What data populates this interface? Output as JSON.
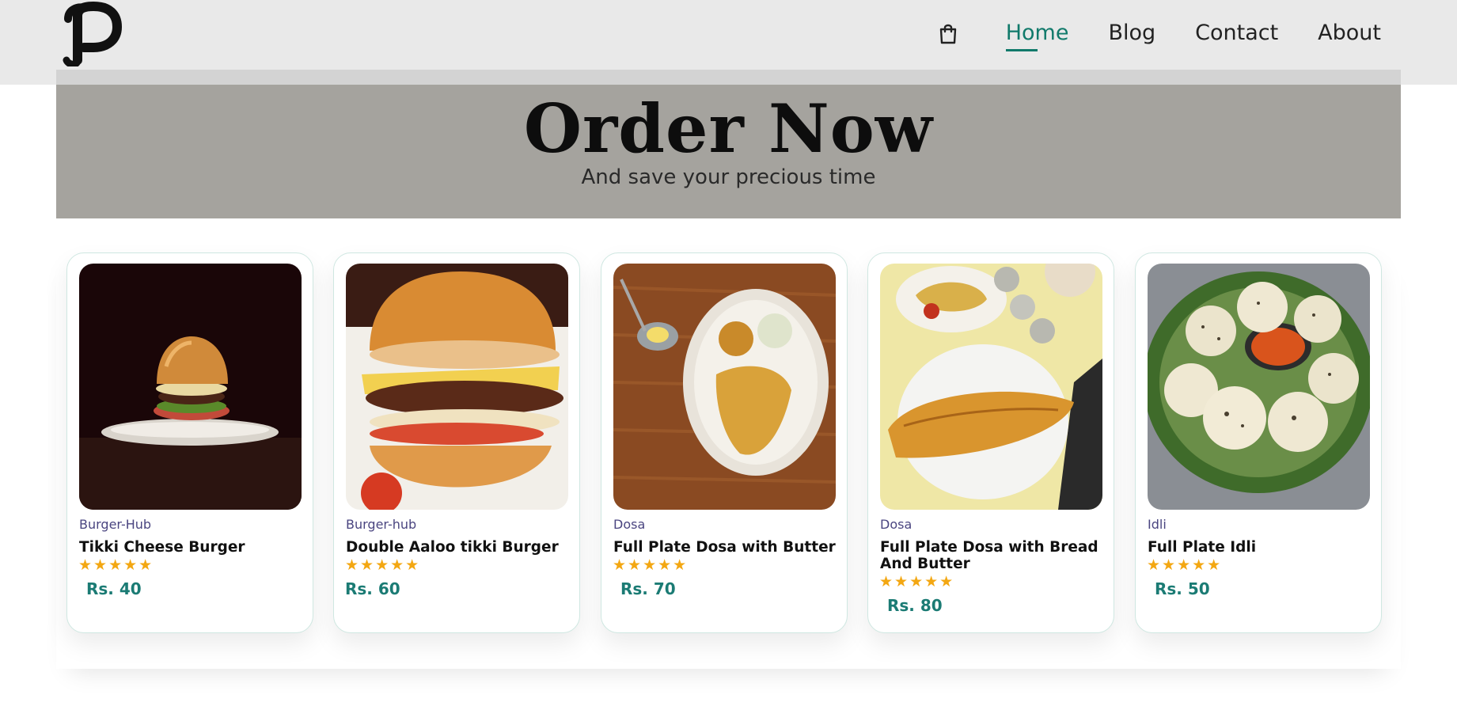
{
  "header": {
    "logo_icon": "p-logo-icon",
    "cart_icon": "shopping-bag-icon",
    "nav": [
      {
        "label": "Home",
        "active": true
      },
      {
        "label": "Blog",
        "active": false
      },
      {
        "label": "Contact",
        "active": false
      },
      {
        "label": "About",
        "active": false
      }
    ],
    "accent_color": "#117a6b"
  },
  "hero": {
    "title": "Order Now",
    "subtitle": "And save your precious time",
    "background": "#a5a39e"
  },
  "products": [
    {
      "category": "Burger-Hub",
      "name": "Tikki Cheese Burger",
      "rating": 5,
      "price": "Rs. 40",
      "image_icon": "cheese-burger-photo"
    },
    {
      "category": "Burger-hub",
      "name": "Double Aaloo tikki Burger",
      "rating": 5,
      "price": "Rs. 60",
      "image_icon": "double-burger-photo"
    },
    {
      "category": "Dosa",
      "name": "Full Plate Dosa with Butter",
      "rating": 5,
      "price": "Rs. 70",
      "image_icon": "dosa-butter-photo"
    },
    {
      "category": "Dosa",
      "name": "Full Plate Dosa with Bread And Butter",
      "rating": 5,
      "price": "Rs. 80",
      "image_icon": "dosa-bread-photo"
    },
    {
      "category": "Idli",
      "name": "Full Plate Idli",
      "rating": 5,
      "price": "Rs. 50",
      "image_icon": "idli-photo"
    }
  ],
  "colors": {
    "star": "#f3a712",
    "price": "#1b7b74",
    "category": "#4a4580"
  }
}
